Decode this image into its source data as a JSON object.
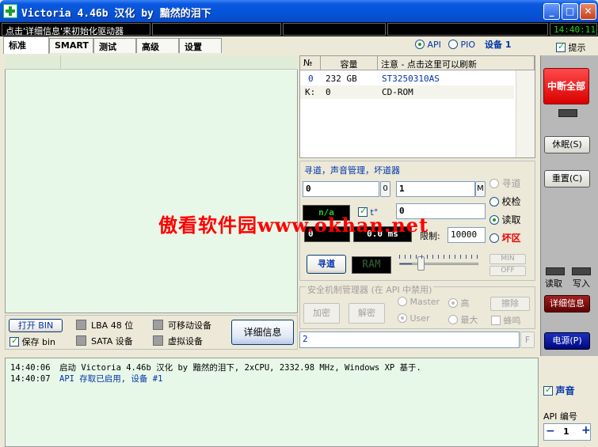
{
  "window": {
    "title": "Victoria 4.46b 汉化 by 黯然的泪下",
    "minimize_glyph": "_",
    "maximize_glyph": "□",
    "close_glyph": "✕"
  },
  "status_bar": {
    "message": "点击'详细信息'来初始化驱动器",
    "clock": "14:40:11"
  },
  "tabs": [
    {
      "label": "标准"
    },
    {
      "label": "SMART"
    },
    {
      "label": "测试"
    },
    {
      "label": "高级"
    },
    {
      "label": "设置"
    }
  ],
  "interface": {
    "api_label": "API",
    "pio_label": "PIO",
    "device_label": "设备 1",
    "selected": "API"
  },
  "hint": {
    "label": "提示",
    "checked": true
  },
  "drive_table": {
    "columns": [
      "№",
      "容量",
      "注意 - 点击这里可以刷新"
    ],
    "rows": [
      {
        "num": "0",
        "capacity": "232 GB",
        "model": "ST3250310AS"
      },
      {
        "num": "K:",
        "capacity": "0",
        "model": "CD-ROM"
      }
    ]
  },
  "seek_panel": {
    "title": "寻道，声音管理，坏道器",
    "start_value": "0",
    "start_btn": "0",
    "end_value": "1",
    "end_btn": "M",
    "lcd_na": "n/a",
    "t_label": "t°",
    "field_value": "0",
    "lcd_zero": "0",
    "lcd_ms": "0.0 ms",
    "limit_label": "限制:",
    "limit_value": "10000",
    "modes": [
      {
        "label": "寻道",
        "state": "disabled"
      },
      {
        "label": "校检",
        "state": "normal"
      },
      {
        "label": "读取",
        "state": "selected"
      },
      {
        "label": "坏区",
        "state": "danger"
      }
    ],
    "seek_button": "寻道",
    "ram_label": "RAM",
    "min_label": "MIN",
    "off_label": "OFF",
    "slider_level": 0.15
  },
  "security_panel": {
    "title": "安全机制管理器 (在 API 中禁用)",
    "encrypt_button": "加密",
    "unlock_button": "解密",
    "master_label": "Master",
    "user_label": "User",
    "high_label": "高",
    "max_label": "最大",
    "erase_button": "擦除",
    "buzz_label": "蜂鸣"
  },
  "options_panel": {
    "open_bin": "打开 BIN",
    "save_bin": "保存 bin",
    "lba48": "LBA 48 位",
    "sata": "SATA 设备",
    "removable": "可移动设备",
    "virtual": "虚拟设备",
    "details_button": "详细信息"
  },
  "command_field": {
    "value": "2",
    "btn": "F"
  },
  "log": [
    {
      "time": "14:40:06",
      "text": "启动 Victoria 4.46b 汉化 by 黯然的泪下, 2xCPU, 2332.98 MHz, Windows XP 基于.",
      "color": "#000000"
    },
    {
      "time": "14:40:07",
      "text": "API 存取已启用, 设备 #1",
      "color": "#0033aa"
    }
  ],
  "right_panel": {
    "stop_all": "中断全部",
    "sleep": "休眠(S)",
    "reset": "重置(C)",
    "read_label": "读取",
    "write_label": "写入",
    "details": "详细信息",
    "power": "电源(P)",
    "sound_label": "声音",
    "api_number_label": "API 编号",
    "api_number_value": "1",
    "minus": "−",
    "plus": "+"
  },
  "watermark": "傲看软件园www.okhan.net"
}
